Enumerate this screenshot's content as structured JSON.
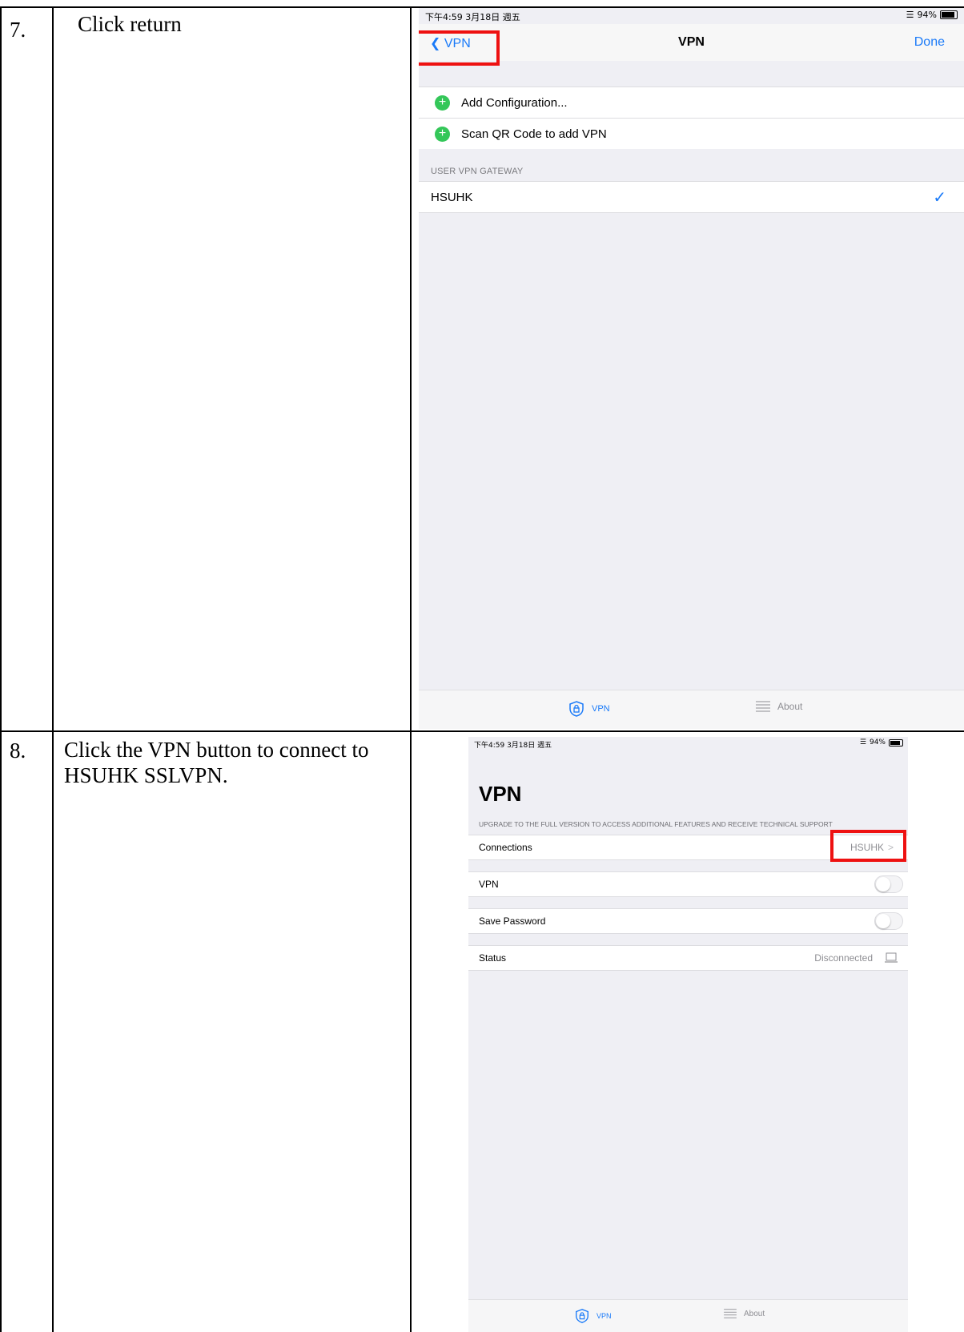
{
  "steps": [
    {
      "number": "7.",
      "instruction": "Click return"
    },
    {
      "number": "8.",
      "instruction_line1": "Click the VPN button to connect to",
      "instruction_line2": "HSUHK SSLVPN."
    }
  ],
  "screen1": {
    "status_time": "下午4:59  3月18日 週五",
    "status_battery": "94%",
    "nav": {
      "back_label": "VPN",
      "title": "VPN",
      "done_label": "Done"
    },
    "add_items": [
      "Add Configuration...",
      "Scan QR Code to add VPN"
    ],
    "section_header": "USER VPN GATEWAY",
    "gateway": "HSUHK",
    "tabs": {
      "vpn": "VPN",
      "about": "About"
    }
  },
  "screen2": {
    "status_time": "下午4:59  3月18日 週五",
    "status_battery": "94%",
    "title": "VPN",
    "upgrade_note": "UPGRADE TO THE FULL VERSION TO ACCESS ADDITIONAL FEATURES AND RECEIVE TECHNICAL SUPPORT",
    "rows": {
      "connections_label": "Connections",
      "connections_value": "HSUHK",
      "vpn_label": "VPN",
      "save_password_label": "Save Password",
      "status_label": "Status",
      "status_value": "Disconnected"
    },
    "tabs": {
      "vpn": "VPN",
      "about": "About"
    }
  },
  "colors": {
    "ios_blue": "#1a7af8",
    "highlight_red": "#ee1111",
    "add_green": "#34c759"
  }
}
